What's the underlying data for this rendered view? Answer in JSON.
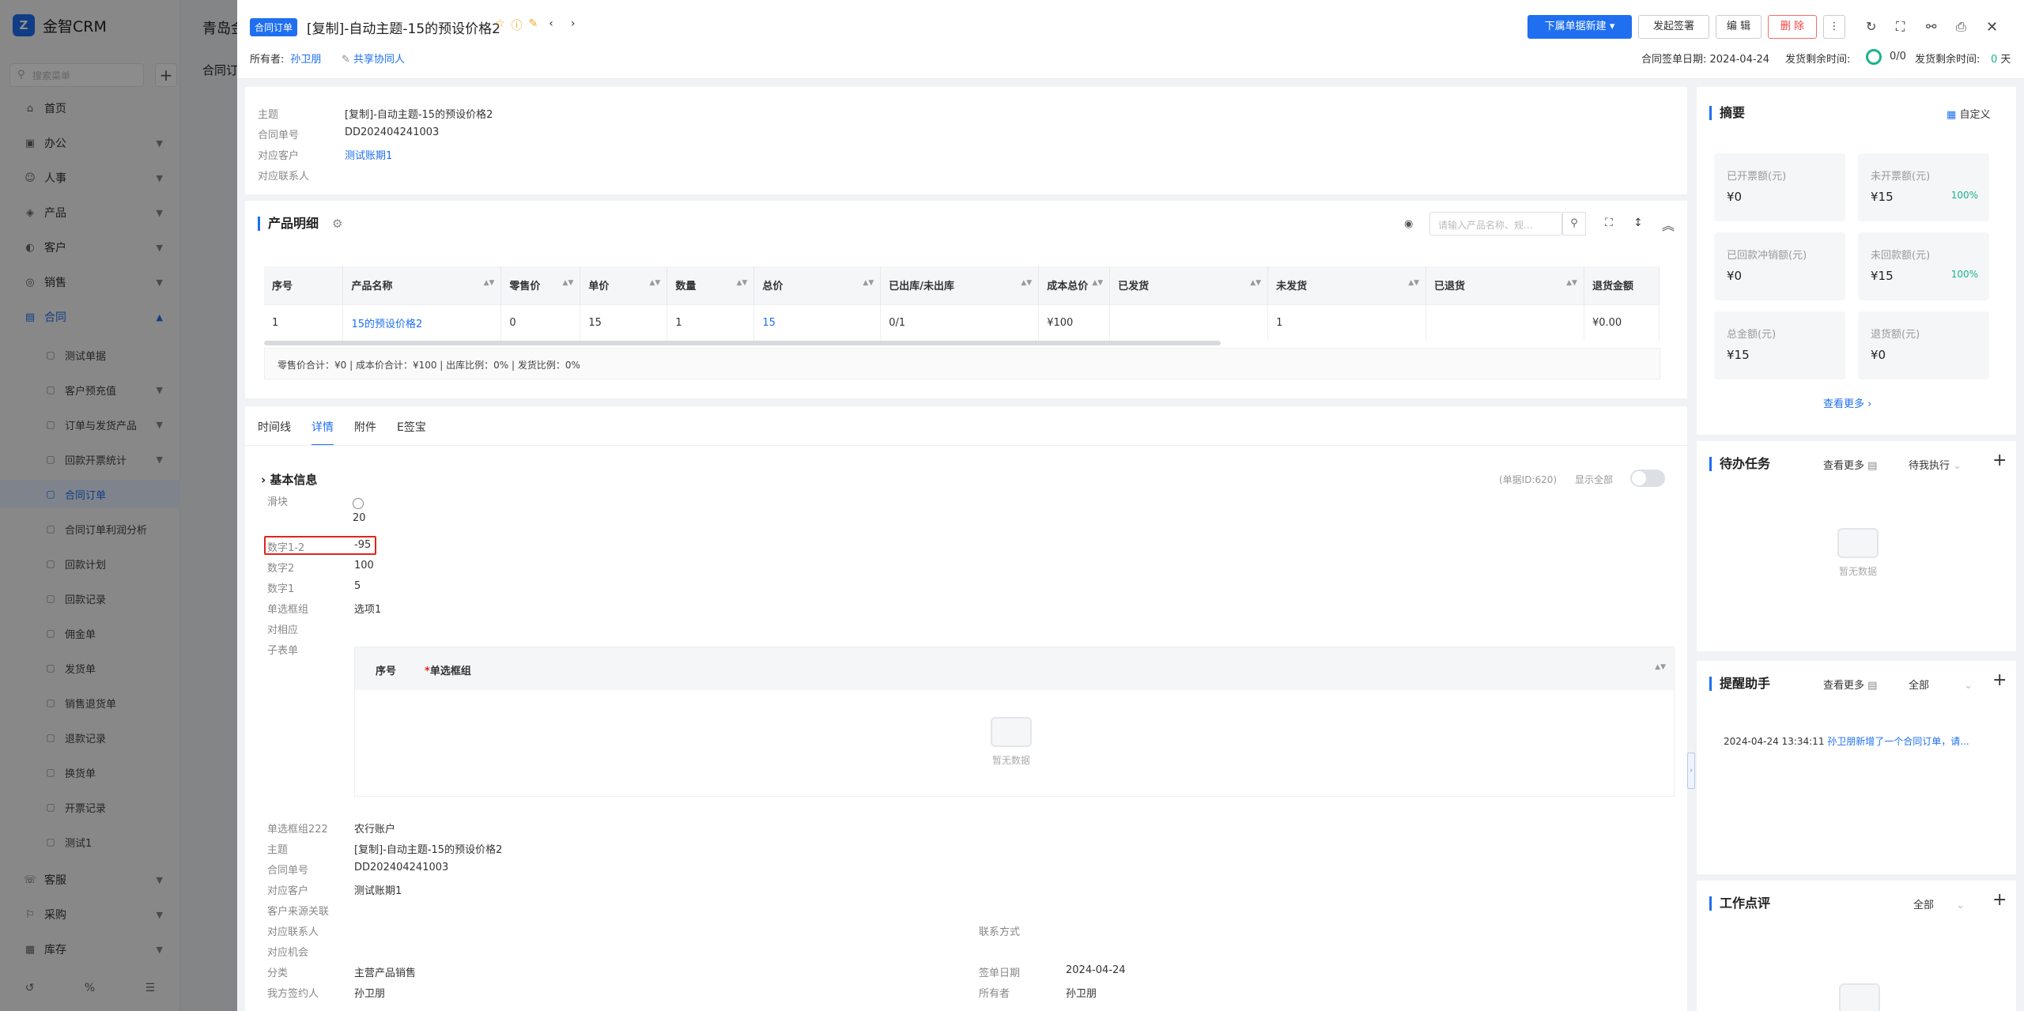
{
  "app": {
    "name": "金智CRM",
    "logo_letter": "Z"
  },
  "sidebar": {
    "search_placeholder": "搜索菜单",
    "items": [
      {
        "label": "首页",
        "icon": "home-icon"
      },
      {
        "label": "办公",
        "icon": "office-icon"
      },
      {
        "label": "人事",
        "icon": "person-icon"
      },
      {
        "label": "产品",
        "icon": "product-icon"
      },
      {
        "label": "客户",
        "icon": "customer-icon"
      },
      {
        "label": "销售",
        "icon": "sales-icon"
      },
      {
        "label": "合同",
        "icon": "contract-icon"
      }
    ],
    "sub_items": [
      {
        "label": "测试单据"
      },
      {
        "label": "客户预充值"
      },
      {
        "label": "订单与发货产品"
      },
      {
        "label": "回款开票统计"
      },
      {
        "label": "合同订单"
      },
      {
        "label": "合同订单利润分析"
      },
      {
        "label": "回款计划"
      },
      {
        "label": "回款记录"
      },
      {
        "label": "佣金单"
      },
      {
        "label": "发货单"
      },
      {
        "label": "销售退货单"
      },
      {
        "label": "退款记录"
      },
      {
        "label": "换货单"
      },
      {
        "label": "开票记录"
      },
      {
        "label": "测试1"
      }
    ],
    "bottom_items": [
      {
        "label": "客服"
      },
      {
        "label": "采购"
      },
      {
        "label": "库存"
      }
    ]
  },
  "background": {
    "title": "青岛金",
    "subtitle": "合同订"
  },
  "header": {
    "tag": "合同订单",
    "title": "[复制]-自动主题-15的预设价格2",
    "owner_label": "所有者:",
    "owner": "孙卫朋",
    "collab": "共享协同人",
    "buttons": {
      "new_sub": "下属单据新建",
      "sign": "发起签署",
      "edit": "编 辑",
      "delete": "删 除"
    },
    "contract_date_label": "合同签单日期:",
    "contract_date": "2024-04-24",
    "ship_remain_label": "发货剩余时间:",
    "ship_ratio": "0/0",
    "ship_remain_label2": "发货剩余时间:",
    "ship_days": "0",
    "ship_days_unit": "天"
  },
  "summary_card": {
    "rows": [
      {
        "label": "主题",
        "value": "[复制]-自动主题-15的预设价格2"
      },
      {
        "label": "合同单号",
        "value": "DD202404241003"
      },
      {
        "label": "对应客户",
        "value": "测试账期1",
        "link": true
      },
      {
        "label": "对应联系人",
        "value": ""
      }
    ]
  },
  "products": {
    "title": "产品明细",
    "search_placeholder": "请输入产品名称、规...",
    "columns": [
      "序号",
      "产品名称",
      "零售价",
      "单价",
      "数量",
      "总价",
      "已出库/未出库",
      "成本总价",
      "已发货",
      "未发货",
      "已退货",
      "退货金额"
    ],
    "rows": [
      [
        "1",
        "15的预设价格2",
        "0",
        "15",
        "1",
        "15",
        "0/1",
        "¥100",
        "",
        "1",
        "",
        "¥0.00"
      ]
    ],
    "footer": "零售价合计：¥0 |   成本价合计：¥100 |   出库比例：0% |   发货比例：0%"
  },
  "tabs": [
    "时间线",
    "详情",
    "附件",
    "E签宝"
  ],
  "detail": {
    "section": "基本信息",
    "doc_id": "(单据ID:620)",
    "show_all": "显示全部",
    "fields_top": [
      {
        "label": "滑块",
        "value": "20"
      },
      {
        "label": "数字1-2",
        "value": "-95"
      },
      {
        "label": "数字2",
        "value": "100"
      },
      {
        "label": "数字1",
        "value": "5"
      },
      {
        "label": "单选框组",
        "value": "选项1"
      },
      {
        "label": "对相应",
        "value": ""
      },
      {
        "label": "子表单",
        "value": ""
      }
    ],
    "subtable_cols": [
      "序号",
      "单选框组"
    ],
    "empty": "暂无数据",
    "fields_bottom": [
      {
        "label": "单选框组222",
        "value": "农行账户"
      },
      {
        "label": "主题",
        "value": "[复制]-自动主题-15的预设价格2"
      },
      {
        "label": "合同单号",
        "value": "DD202404241003"
      },
      {
        "label": "对应客户",
        "value": "测试账期1",
        "link": true
      },
      {
        "label": "客户来源关联",
        "value": ""
      },
      {
        "label": "对应联系人",
        "value": ""
      },
      {
        "label": "对应机会",
        "value": ""
      },
      {
        "label": "分类",
        "value": "主营产品销售"
      },
      {
        "label": "我方签约人",
        "value": "孙卫朋"
      }
    ],
    "fields_right": [
      {
        "label": "联系方式",
        "value": ""
      },
      {
        "label": "签单日期",
        "value": "2024-04-24"
      },
      {
        "label": "所有者",
        "value": "孙卫朋"
      }
    ]
  },
  "right": {
    "summary": {
      "title": "摘要",
      "customize": "自定义",
      "more": "查看更多",
      "stats": [
        {
          "k": "已开票额(元)",
          "v": "¥0",
          "p": ""
        },
        {
          "k": "未开票额(元)",
          "v": "¥15",
          "p": "100%"
        },
        {
          "k": "已回款冲销额(元)",
          "v": "¥0",
          "p": ""
        },
        {
          "k": "未回款额(元)",
          "v": "¥15",
          "p": "100%"
        },
        {
          "k": "总金额(元)",
          "v": "¥15",
          "p": ""
        },
        {
          "k": "退货额(元)",
          "v": "¥0",
          "p": ""
        }
      ]
    },
    "todo": {
      "title": "待办任务",
      "more": "查看更多",
      "filter": "待我执行",
      "empty": "暂无数据"
    },
    "reminder": {
      "title": "提醒助手",
      "more": "查看更多",
      "filter": "全部",
      "time": "2024-04-24 13:34:11",
      "text": "孙卫朋新增了一个合同订单，请..."
    },
    "review": {
      "title": "工作点评",
      "filter": "全部"
    }
  },
  "colors": {
    "accent": "#1f6ff0",
    "danger": "#f23d3d",
    "success": "#18b48d",
    "highlight": "#e0251b"
  }
}
